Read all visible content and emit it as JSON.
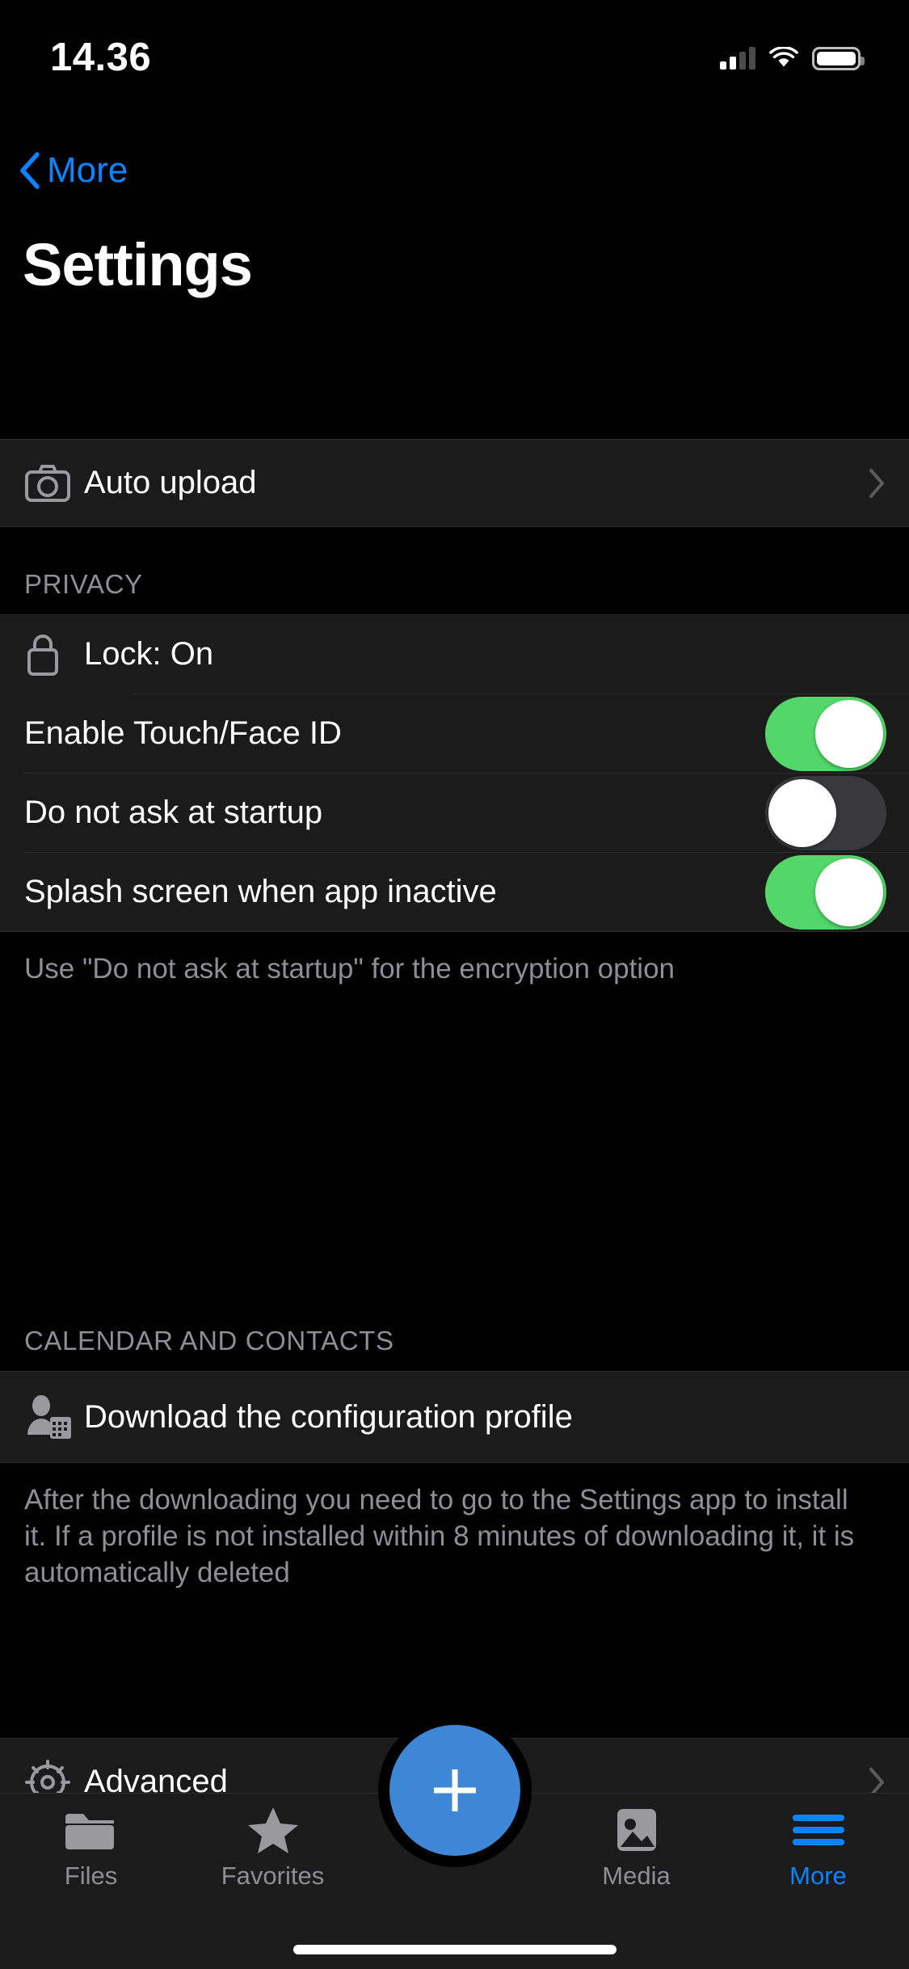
{
  "status_bar": {
    "time": "14.36",
    "signal_icon": "cellular-signal-icon",
    "wifi_icon": "wifi-icon",
    "battery_icon": "battery-icon"
  },
  "nav": {
    "back_label": "More",
    "back_icon": "chevron-left-icon",
    "title": "Settings"
  },
  "sections": {
    "auto_upload": {
      "label": "Auto upload",
      "icon": "camera-icon",
      "accessory": "chevron-right-icon"
    },
    "privacy": {
      "header": "PRIVACY",
      "footer": "Use \"Do not ask at startup\" for the encryption option",
      "rows": [
        {
          "label": "Lock: On",
          "icon": "lock-icon",
          "type": "link"
        },
        {
          "label": "Enable Touch/Face ID",
          "type": "toggle",
          "value": "on"
        },
        {
          "label": "Do not ask at startup",
          "type": "toggle",
          "value": "off"
        },
        {
          "label": "Splash screen when app inactive",
          "type": "toggle",
          "value": "on"
        }
      ]
    },
    "calendar_contacts": {
      "header": "CALENDAR AND CONTACTS",
      "footer": "After the downloading you need to go to the Settings app to install it. If a profile is not installed within 8 minutes of downloading it, it is automatically deleted",
      "rows": [
        {
          "label": "Download the configuration profile",
          "icon": "person-calendar-icon"
        }
      ]
    },
    "advanced": {
      "label": "Advanced",
      "icon": "gear-icon",
      "accessory": "chevron-right-icon"
    }
  },
  "tab_bar": {
    "tabs": [
      {
        "label": "Files",
        "icon": "folder-icon",
        "active": false
      },
      {
        "label": "Favorites",
        "icon": "star-icon",
        "active": false
      },
      {
        "label": "Media",
        "icon": "photo-icon",
        "active": false
      },
      {
        "label": "More",
        "icon": "hamburger-icon",
        "active": true
      }
    ],
    "fab": {
      "icon": "plus-icon"
    }
  },
  "colors": {
    "accent": "#0a84ff",
    "toggle_on": "#53d769",
    "toggle_off": "#39393d",
    "fab": "#3d87d6",
    "row_bg": "#1b1b1b",
    "page_bg": "#000000",
    "secondary_text": "#8e8e93"
  }
}
